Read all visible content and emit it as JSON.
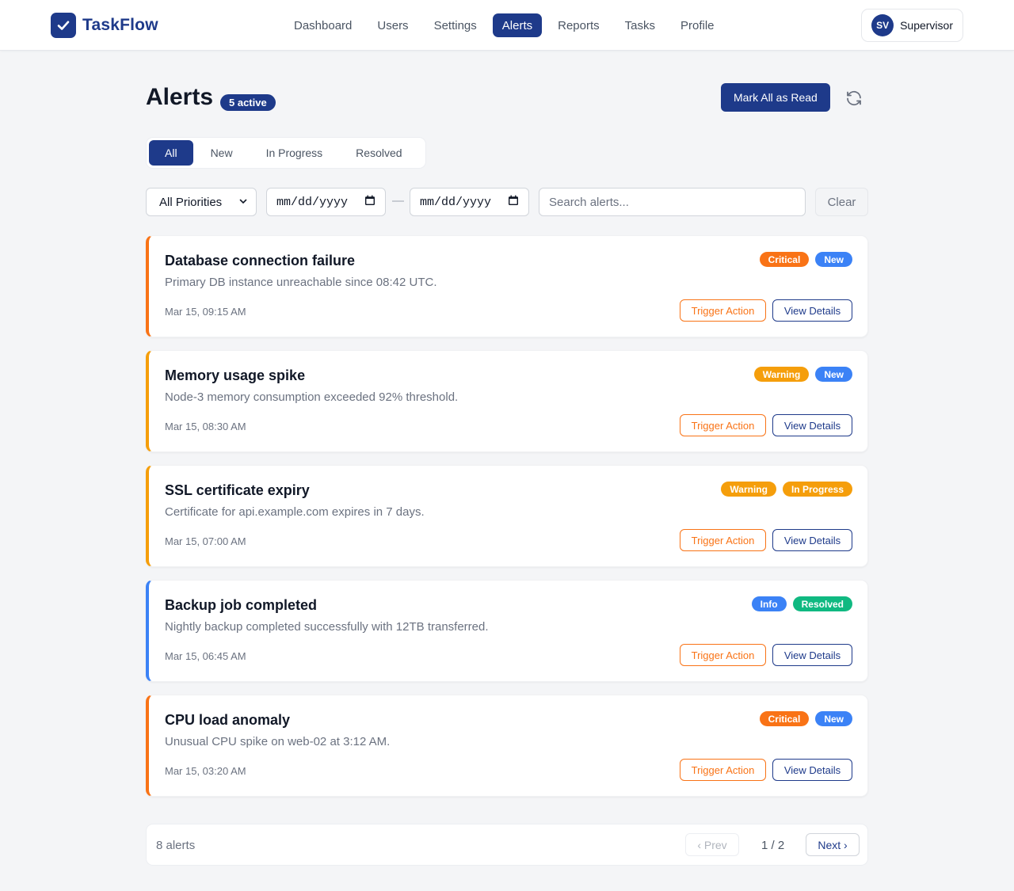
{
  "app": {
    "name": "TaskFlow"
  },
  "nav": {
    "items": [
      {
        "label": "Dashboard",
        "active": false
      },
      {
        "label": "Users",
        "active": false
      },
      {
        "label": "Settings",
        "active": false
      },
      {
        "label": "Alerts",
        "active": true
      },
      {
        "label": "Reports",
        "active": false
      },
      {
        "label": "Tasks",
        "active": false
      },
      {
        "label": "Profile",
        "active": false
      }
    ]
  },
  "user": {
    "initials": "SV",
    "name": "Supervisor"
  },
  "page": {
    "title": "Alerts",
    "active_badge": "5 active",
    "mark_all_label": "Mark All as Read",
    "refresh_icon": "refresh-icon"
  },
  "tabs": [
    {
      "label": "All",
      "active": true
    },
    {
      "label": "New",
      "active": false
    },
    {
      "label": "In Progress",
      "active": false
    },
    {
      "label": "Resolved",
      "active": false
    }
  ],
  "filters": {
    "priority_value": "All Priorities",
    "date_from_placeholder": "mm/dd/yyyy",
    "date_separator": "—",
    "date_to_placeholder": "mm/dd/yyyy",
    "search_placeholder": "Search alerts...",
    "clear_label": "Clear"
  },
  "colors": {
    "primary": "#1e3a8a",
    "critical": "#f97316",
    "warning": "#f59e0b",
    "info": "#3b82f6",
    "new": "#3b82f6",
    "in_progress": "#f59e0b",
    "resolved": "#10b981"
  },
  "alerts": [
    {
      "title": "Database connection failure",
      "description": "Primary DB instance unreachable since 08:42 UTC.",
      "time": "Mar 15, 09:15 AM",
      "priority": "Critical",
      "status": "New",
      "accent": "#f97316",
      "priority_color": "#f97316",
      "status_color": "#3b82f6",
      "trigger_label": "Trigger Action",
      "view_label": "View Details"
    },
    {
      "title": "Memory usage spike",
      "description": "Node-3 memory consumption exceeded 92% threshold.",
      "time": "Mar 15, 08:30 AM",
      "priority": "Warning",
      "status": "New",
      "accent": "#f59e0b",
      "priority_color": "#f59e0b",
      "status_color": "#3b82f6",
      "trigger_label": "Trigger Action",
      "view_label": "View Details"
    },
    {
      "title": "SSL certificate expiry",
      "description": "Certificate for api.example.com expires in 7 days.",
      "time": "Mar 15, 07:00 AM",
      "priority": "Warning",
      "status": "In Progress",
      "accent": "#f59e0b",
      "priority_color": "#f59e0b",
      "status_color": "#f59e0b",
      "trigger_label": "Trigger Action",
      "view_label": "View Details"
    },
    {
      "title": "Backup job completed",
      "description": "Nightly backup completed successfully with 12TB transferred.",
      "time": "Mar 15, 06:45 AM",
      "priority": "Info",
      "status": "Resolved",
      "accent": "#3b82f6",
      "priority_color": "#3b82f6",
      "status_color": "#10b981",
      "trigger_label": "Trigger Action",
      "view_label": "View Details"
    },
    {
      "title": "CPU load anomaly",
      "description": "Unusual CPU spike on web-02 at 3:12 AM.",
      "time": "Mar 15, 03:20 AM",
      "priority": "Critical",
      "status": "New",
      "accent": "#f97316",
      "priority_color": "#f97316",
      "status_color": "#3b82f6",
      "trigger_label": "Trigger Action",
      "view_label": "View Details"
    }
  ],
  "pagination": {
    "count": "8 alerts",
    "prev_label": "‹ Prev",
    "indicator": "1 / 2",
    "next_label": "Next ›"
  }
}
